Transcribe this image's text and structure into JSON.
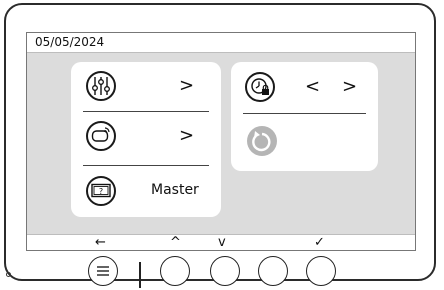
{
  "status_bar": {
    "date": "05/05/2024"
  },
  "menu_left": {
    "rows": [
      {
        "icon": "sliders-icon",
        "action": ">"
      },
      {
        "icon": "intercom-device-icon",
        "action": ">"
      },
      {
        "icon": "help-monitor-icon",
        "label": "Master"
      }
    ]
  },
  "menu_right": {
    "rows": [
      {
        "icon": "clock-lock-icon",
        "prev": "<",
        "next": ">"
      },
      {
        "icon": "reset-icon"
      }
    ]
  },
  "nav_bar": {
    "back": "←",
    "up": "^",
    "down": "v",
    "confirm": "✓"
  },
  "colors": {
    "screen_bg": "#dcdcdc",
    "card_bg": "#ffffff",
    "reset_icon": "#b5b5b5"
  }
}
